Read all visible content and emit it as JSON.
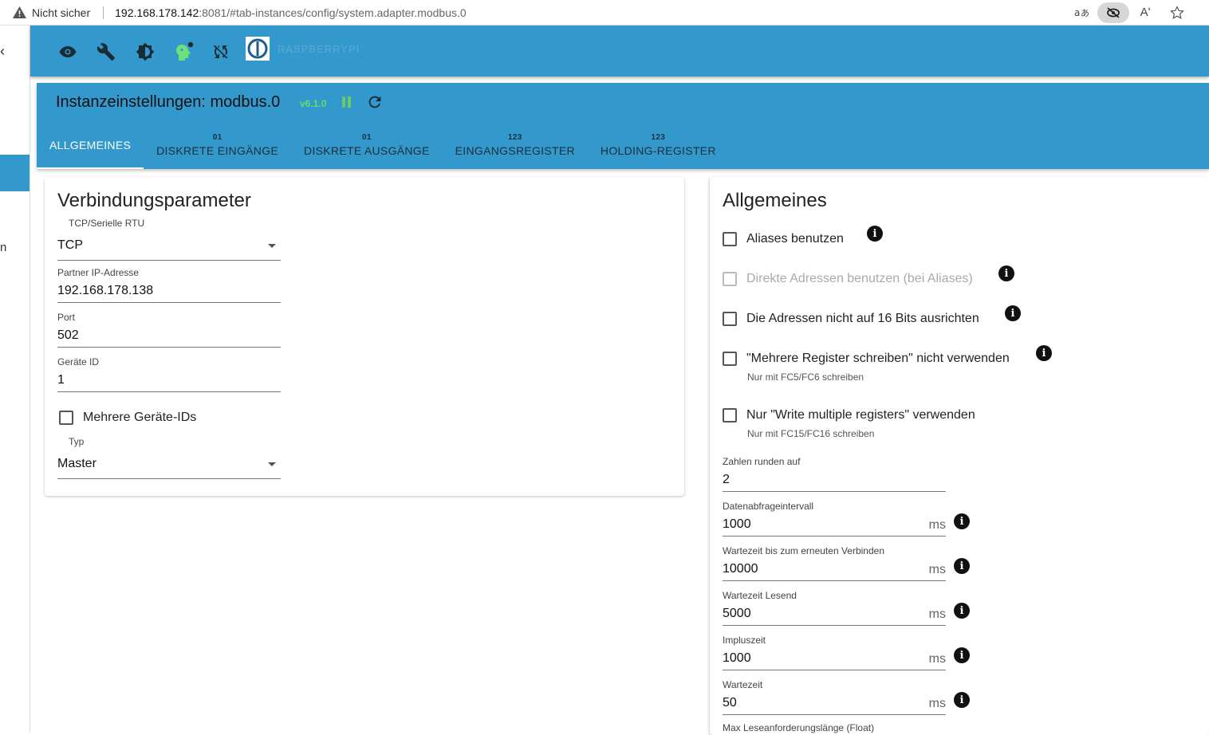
{
  "browser": {
    "not_secure": "Nicht sicher",
    "url_host": "192.168.178.142",
    "url_rest": ":8081/#tab-instances/config/system.adapter.modbus.0",
    "read_aloud_label": "Aʹ"
  },
  "drawer": {
    "chevron": "‹",
    "cut_letter": "n"
  },
  "appbar": {
    "icons": [
      "eye-icon",
      "wrench-icon",
      "brightness-icon",
      "expert-head-icon",
      "sync-off-icon",
      "iobroker-logo"
    ],
    "host_name": "RASPBERRYPI"
  },
  "instance": {
    "title": "Instanzeinstellungen: modbus.0",
    "version": "v6.1.0",
    "tabs": [
      {
        "badge": "",
        "label": "ALLGEMEINES"
      },
      {
        "badge": "01",
        "label": "DISKRETE EINGÄNGE"
      },
      {
        "badge": "01",
        "label": "DISKRETE AUSGÄNGE"
      },
      {
        "badge": "123",
        "label": "EINGANGSREGISTER"
      },
      {
        "badge": "123",
        "label": "HOLDING-REGISTER"
      }
    ]
  },
  "connection": {
    "title": "Verbindungsparameter",
    "mode_label": "TCP/Serielle RTU",
    "mode_value": "TCP",
    "ip_label": "Partner IP-Adresse",
    "ip_value": "192.168.178.138",
    "port_label": "Port",
    "port_value": "502",
    "device_id_label": "Geräte ID",
    "device_id_value": "1",
    "multi_ids_label": "Mehrere Geräte-IDs",
    "type_label": "Typ",
    "type_value": "Master"
  },
  "general": {
    "title": "Allgemeines",
    "aliases_label": "Aliases benutzen",
    "direct_addresses_label": "Direkte Adressen benutzen (bei Aliases)",
    "no_align_label": "Die Adressen nicht auf 16 Bits ausrichten",
    "no_multi_write_label": "\"Mehrere Register schreiben\" nicht verwenden",
    "no_multi_write_help": "Nur mit FC5/FC6 schreiben",
    "only_multi_write_label": "Nur \"Write multiple registers\" verwenden",
    "only_multi_write_help": "Nur mit FC15/FC16 schreiben",
    "round_label": "Zahlen runden auf",
    "round_value": "2",
    "poll_label": "Datenabfrageintervall",
    "poll_value": "1000",
    "reconnect_label": "Wartezeit bis zum erneuten Verbinden",
    "reconnect_value": "10000",
    "read_timeout_label": "Wartezeit Lesend",
    "read_timeout_value": "5000",
    "pulse_label": "Impluszeit",
    "pulse_value": "1000",
    "wait_label": "Wartezeit",
    "wait_value": "50",
    "max_read_label": "Max Leseanforderungslänge (Float)",
    "unit": "ms",
    "info_glyph": "i"
  },
  "colors": {
    "primary": "#3399cc",
    "version_green": "#66dd66"
  }
}
